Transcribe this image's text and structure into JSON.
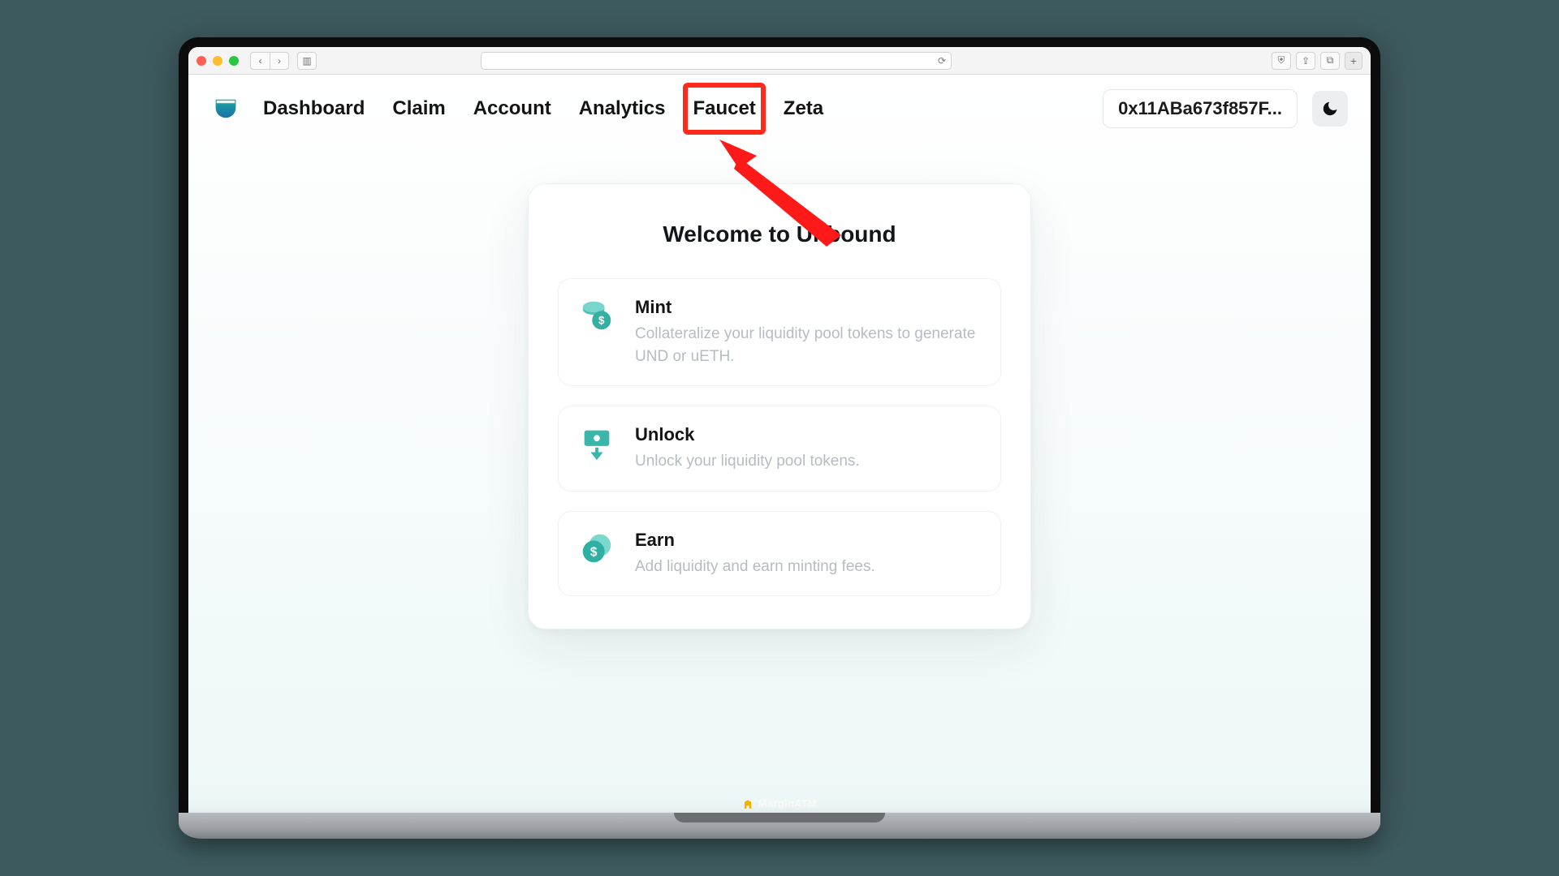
{
  "nav": {
    "items": [
      {
        "label": "Dashboard"
      },
      {
        "label": "Claim"
      },
      {
        "label": "Account"
      },
      {
        "label": "Analytics"
      },
      {
        "label": "Faucet"
      },
      {
        "label": "Zeta"
      }
    ],
    "highlighted_index": 4
  },
  "wallet": {
    "address_short": "0x11ABa673f857F..."
  },
  "card": {
    "title": "Welcome to Unbound",
    "options": [
      {
        "key": "mint",
        "title": "Mint",
        "desc": "Collateralize your liquidity pool tokens to generate UND or uETH."
      },
      {
        "key": "unlock",
        "title": "Unlock",
        "desc": "Unlock your liquidity pool tokens."
      },
      {
        "key": "earn",
        "title": "Earn",
        "desc": "Add liquidity and earn minting fees."
      }
    ]
  },
  "branding": {
    "footer": "MarginATM"
  },
  "colors": {
    "accent": "#2fb9ae",
    "highlight": "#ff2a1a"
  }
}
